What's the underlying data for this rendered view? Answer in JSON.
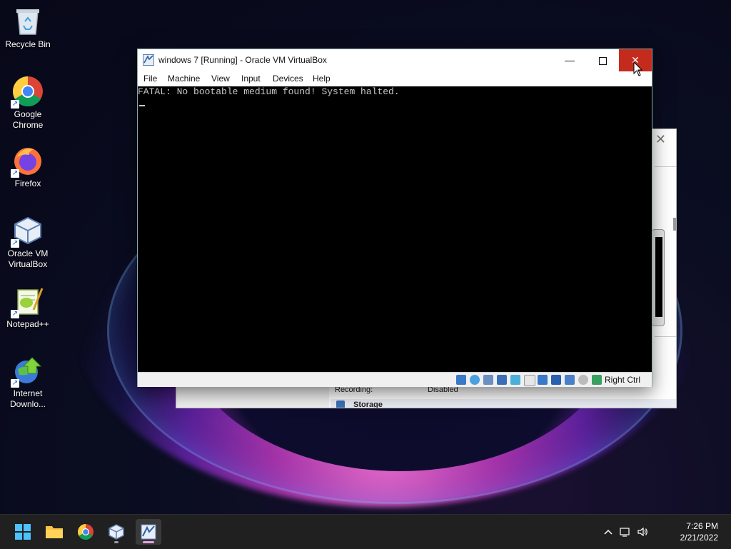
{
  "desktop": {
    "icons": [
      {
        "label": "Recycle Bin"
      },
      {
        "label": "Google\nChrome"
      },
      {
        "label": "Firefox"
      },
      {
        "label": "Oracle VM\nVirtualBox"
      },
      {
        "label": "Notepad++"
      },
      {
        "label": "Internet\nDownlo..."
      }
    ]
  },
  "background_window": {
    "recording_label": "Recording:",
    "recording_value": "Disabled",
    "section_storage": "Storage"
  },
  "vm_window": {
    "title": "windows 7 [Running] - Oracle VM VirtualBox",
    "menu": [
      "File",
      "Machine",
      "View",
      "Input",
      "Devices",
      "Help"
    ],
    "console_text": "FATAL: No bootable medium found! System halted.",
    "host_key": "Right Ctrl",
    "status_icons": [
      "hard-disk",
      "optical-drive",
      "audio",
      "network",
      "usb",
      "shared-folders",
      "display",
      "video-capture",
      "cpu-virtualization",
      "mouse-integration",
      "keyboard-capture"
    ]
  },
  "taskbar": {
    "items": [
      "start",
      "file-explorer",
      "google-chrome",
      "oracle-vm-virtualbox",
      "virtualbox-vm-window"
    ],
    "time": "7:26 PM",
    "date": "2/21/2022"
  },
  "colors": {
    "close_button": "#c42b1c",
    "taskbar": "#202020",
    "accent_underline": "#e6a0e0"
  }
}
